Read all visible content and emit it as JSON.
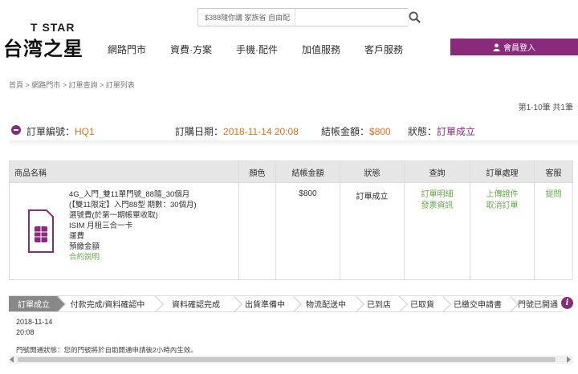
{
  "header": {
    "logo_top": "T STAR",
    "logo_main": "台湾之星",
    "search_links": "$388隨你講  家族省  自由配",
    "search_placeholder": "",
    "nav": [
      "網路門市",
      "資費·方案",
      "手機·配件",
      "加值服務",
      "客戶服務"
    ],
    "login_label": "會員登入"
  },
  "breadcrumb": "首頁 > 網路門市 > 訂單查詢 > 訂單列表",
  "pager": "第1-10筆 共1筆",
  "order": {
    "no_label": "訂單編號：",
    "no_value": "HQ1",
    "date_label": "訂購日期：",
    "date_value": "2018-11-14 20:08",
    "amount_label": "結帳金額：",
    "amount_value": "$800",
    "status_label": "狀態：",
    "status_value": "訂單成立"
  },
  "table": {
    "headers": [
      "商品名稱",
      "顏色",
      "結帳金額",
      "狀態",
      "查詢",
      "訂單處理",
      "客服"
    ],
    "product_lines": [
      "4G_入門_雙11單門號_88隨_30個月",
      "(【雙11限定】入門88型 期數：30個月)",
      "選號費(於第一期帳單收取)",
      "ISIM 月租三合一卡",
      "運費",
      "預繳金額"
    ],
    "product_link": "合約說明",
    "color": "",
    "amount": "$800",
    "status": "訂單成立",
    "query_links": [
      "訂單明細",
      "發票資訊"
    ],
    "process_links": [
      "上傳證件",
      "取消訂單"
    ],
    "service_link": "提問"
  },
  "steps": [
    "訂單成立",
    "付款完成/資料確認中",
    "資料確認完成",
    "出貨準備中",
    "物流配送中",
    "已到店",
    "已取貨",
    "已繳交申請書",
    "門號已開通"
  ],
  "step_date": "2018-11-14",
  "step_time": "20:08",
  "notice": "門號開通狀態：您的門號將於自助開通申請後2小時內生效。",
  "colors": {
    "brand": "#8a2a7a",
    "accent": "#e07020",
    "link": "#6aa84f"
  }
}
